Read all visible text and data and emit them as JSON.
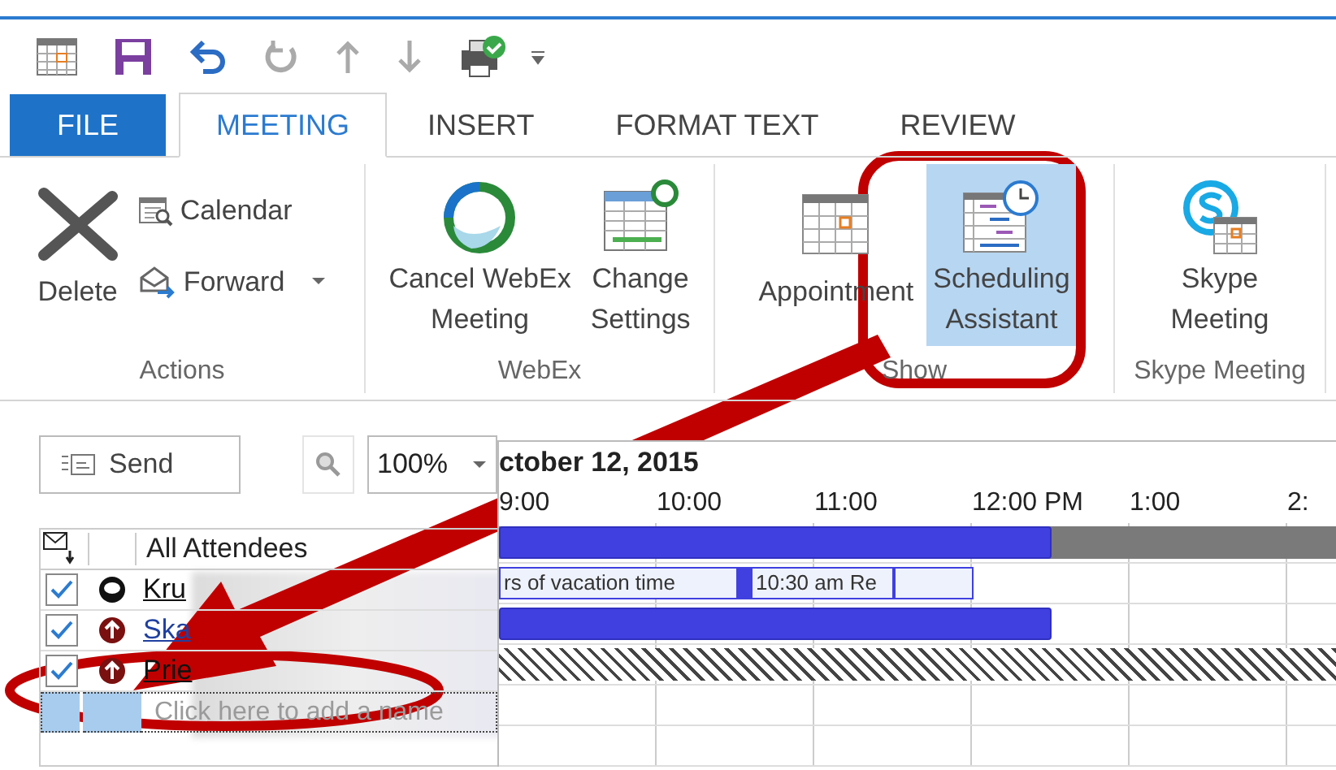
{
  "tabs": [
    {
      "label": "FILE",
      "kind": "file",
      "selected": false
    },
    {
      "label": "MEETING",
      "kind": "tab",
      "selected": true
    },
    {
      "label": "INSERT",
      "kind": "tab",
      "selected": false
    },
    {
      "label": "FORMAT TEXT",
      "kind": "tab",
      "selected": false
    },
    {
      "label": "REVIEW",
      "kind": "tab",
      "selected": false
    }
  ],
  "ribbon_groups": [
    {
      "label": "Actions",
      "buttons": [
        {
          "label": "Delete",
          "kind": "delete",
          "selected": false
        },
        {
          "label": "Calendar",
          "kind": "calendar",
          "selected": false
        },
        {
          "label": "Forward",
          "kind": "forward",
          "selected": false
        }
      ]
    },
    {
      "label": "WebEx",
      "buttons": [
        {
          "label": "Cancel WebEx Meeting",
          "kind": "webex",
          "selected": false
        },
        {
          "label": "Change Settings",
          "kind": "settings",
          "selected": false
        }
      ]
    },
    {
      "label": "Show",
      "buttons": [
        {
          "label": "Appointment",
          "kind": "appointment",
          "selected": false
        },
        {
          "label": "Scheduling Assistant",
          "kind": "scheduling",
          "selected": true
        }
      ]
    },
    {
      "label": "Skype Meeting",
      "buttons": [
        {
          "label": "Skype Meeting",
          "kind": "skype",
          "selected": false
        }
      ]
    }
  ],
  "toolbar": {
    "send": "Send",
    "zoom": "100%"
  },
  "timeline": {
    "date": "ctober 12, 2015",
    "hours": [
      "9:00",
      "10:00",
      "11:00",
      "12:00 PM",
      "1:00",
      "2:"
    ]
  },
  "attendees": {
    "header": "All Attendees",
    "placeholder": "Click here to add a name",
    "rows": [
      {
        "name": "Kru",
        "checked": true,
        "kind": "organizer"
      },
      {
        "name": "Ska",
        "checked": true,
        "kind": "required"
      },
      {
        "name": "Prie",
        "checked": true,
        "kind": "required"
      }
    ]
  },
  "schedule_rows": [
    {
      "kind": "busy",
      "off_hours": true,
      "level": 0.585
    },
    {
      "kind": "events",
      "off_hours": false,
      "events": [
        {
          "kind": "tentative",
          "text": "rs of vacation time"
        },
        {
          "kind": "busy"
        },
        {
          "kind": "tentative",
          "text": "10:30 am Re"
        },
        {
          "kind": "tentative"
        }
      ]
    },
    {
      "kind": "busy",
      "off_hours": false,
      "level": 0.585
    },
    {
      "kind": "unknown",
      "level": 1
    }
  ]
}
